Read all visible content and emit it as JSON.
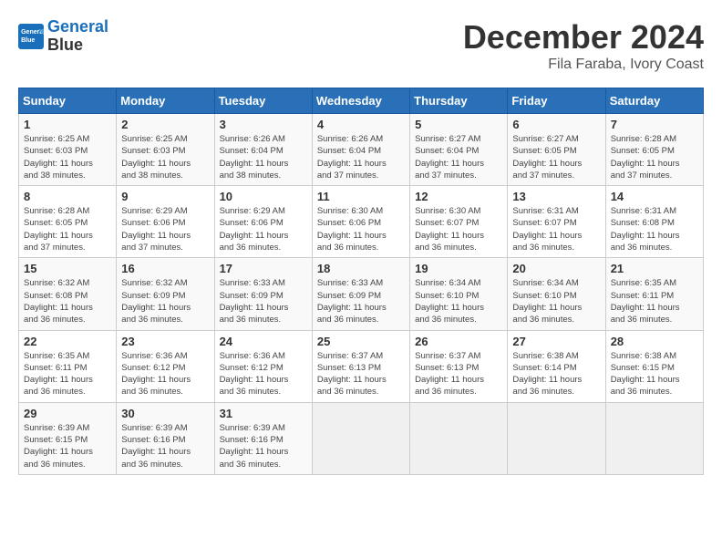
{
  "header": {
    "logo_line1": "General",
    "logo_line2": "Blue",
    "title": "December 2024",
    "subtitle": "Fila Faraba, Ivory Coast"
  },
  "weekdays": [
    "Sunday",
    "Monday",
    "Tuesday",
    "Wednesday",
    "Thursday",
    "Friday",
    "Saturday"
  ],
  "weeks": [
    [
      {
        "day": "1",
        "info": "Sunrise: 6:25 AM\nSunset: 6:03 PM\nDaylight: 11 hours\nand 38 minutes."
      },
      {
        "day": "2",
        "info": "Sunrise: 6:25 AM\nSunset: 6:03 PM\nDaylight: 11 hours\nand 38 minutes."
      },
      {
        "day": "3",
        "info": "Sunrise: 6:26 AM\nSunset: 6:04 PM\nDaylight: 11 hours\nand 38 minutes."
      },
      {
        "day": "4",
        "info": "Sunrise: 6:26 AM\nSunset: 6:04 PM\nDaylight: 11 hours\nand 37 minutes."
      },
      {
        "day": "5",
        "info": "Sunrise: 6:27 AM\nSunset: 6:04 PM\nDaylight: 11 hours\nand 37 minutes."
      },
      {
        "day": "6",
        "info": "Sunrise: 6:27 AM\nSunset: 6:05 PM\nDaylight: 11 hours\nand 37 minutes."
      },
      {
        "day": "7",
        "info": "Sunrise: 6:28 AM\nSunset: 6:05 PM\nDaylight: 11 hours\nand 37 minutes."
      }
    ],
    [
      {
        "day": "8",
        "info": "Sunrise: 6:28 AM\nSunset: 6:05 PM\nDaylight: 11 hours\nand 37 minutes."
      },
      {
        "day": "9",
        "info": "Sunrise: 6:29 AM\nSunset: 6:06 PM\nDaylight: 11 hours\nand 37 minutes."
      },
      {
        "day": "10",
        "info": "Sunrise: 6:29 AM\nSunset: 6:06 PM\nDaylight: 11 hours\nand 36 minutes."
      },
      {
        "day": "11",
        "info": "Sunrise: 6:30 AM\nSunset: 6:06 PM\nDaylight: 11 hours\nand 36 minutes."
      },
      {
        "day": "12",
        "info": "Sunrise: 6:30 AM\nSunset: 6:07 PM\nDaylight: 11 hours\nand 36 minutes."
      },
      {
        "day": "13",
        "info": "Sunrise: 6:31 AM\nSunset: 6:07 PM\nDaylight: 11 hours\nand 36 minutes."
      },
      {
        "day": "14",
        "info": "Sunrise: 6:31 AM\nSunset: 6:08 PM\nDaylight: 11 hours\nand 36 minutes."
      }
    ],
    [
      {
        "day": "15",
        "info": "Sunrise: 6:32 AM\nSunset: 6:08 PM\nDaylight: 11 hours\nand 36 minutes."
      },
      {
        "day": "16",
        "info": "Sunrise: 6:32 AM\nSunset: 6:09 PM\nDaylight: 11 hours\nand 36 minutes."
      },
      {
        "day": "17",
        "info": "Sunrise: 6:33 AM\nSunset: 6:09 PM\nDaylight: 11 hours\nand 36 minutes."
      },
      {
        "day": "18",
        "info": "Sunrise: 6:33 AM\nSunset: 6:09 PM\nDaylight: 11 hours\nand 36 minutes."
      },
      {
        "day": "19",
        "info": "Sunrise: 6:34 AM\nSunset: 6:10 PM\nDaylight: 11 hours\nand 36 minutes."
      },
      {
        "day": "20",
        "info": "Sunrise: 6:34 AM\nSunset: 6:10 PM\nDaylight: 11 hours\nand 36 minutes."
      },
      {
        "day": "21",
        "info": "Sunrise: 6:35 AM\nSunset: 6:11 PM\nDaylight: 11 hours\nand 36 minutes."
      }
    ],
    [
      {
        "day": "22",
        "info": "Sunrise: 6:35 AM\nSunset: 6:11 PM\nDaylight: 11 hours\nand 36 minutes."
      },
      {
        "day": "23",
        "info": "Sunrise: 6:36 AM\nSunset: 6:12 PM\nDaylight: 11 hours\nand 36 minutes."
      },
      {
        "day": "24",
        "info": "Sunrise: 6:36 AM\nSunset: 6:12 PM\nDaylight: 11 hours\nand 36 minutes."
      },
      {
        "day": "25",
        "info": "Sunrise: 6:37 AM\nSunset: 6:13 PM\nDaylight: 11 hours\nand 36 minutes."
      },
      {
        "day": "26",
        "info": "Sunrise: 6:37 AM\nSunset: 6:13 PM\nDaylight: 11 hours\nand 36 minutes."
      },
      {
        "day": "27",
        "info": "Sunrise: 6:38 AM\nSunset: 6:14 PM\nDaylight: 11 hours\nand 36 minutes."
      },
      {
        "day": "28",
        "info": "Sunrise: 6:38 AM\nSunset: 6:15 PM\nDaylight: 11 hours\nand 36 minutes."
      }
    ],
    [
      {
        "day": "29",
        "info": "Sunrise: 6:39 AM\nSunset: 6:15 PM\nDaylight: 11 hours\nand 36 minutes."
      },
      {
        "day": "30",
        "info": "Sunrise: 6:39 AM\nSunset: 6:16 PM\nDaylight: 11 hours\nand 36 minutes."
      },
      {
        "day": "31",
        "info": "Sunrise: 6:39 AM\nSunset: 6:16 PM\nDaylight: 11 hours\nand 36 minutes."
      },
      {
        "day": "",
        "info": ""
      },
      {
        "day": "",
        "info": ""
      },
      {
        "day": "",
        "info": ""
      },
      {
        "day": "",
        "info": ""
      }
    ]
  ]
}
